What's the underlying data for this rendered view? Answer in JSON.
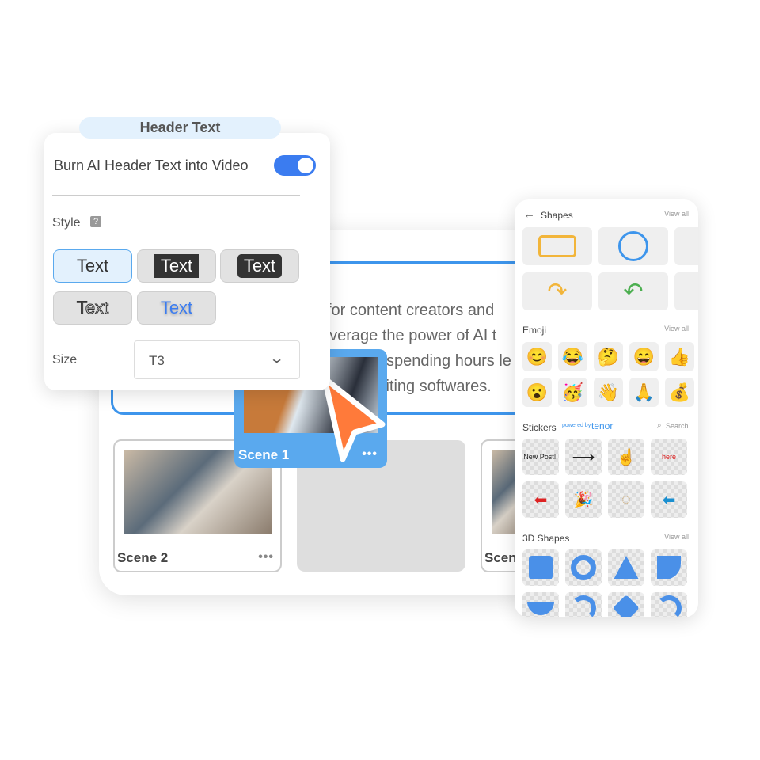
{
  "header_panel": {
    "pill": "Header Text",
    "burn_label": "Burn AI Header Text into Video",
    "burn_on": true,
    "style_label": "Style",
    "style_options": [
      "Text",
      "Text",
      "Text",
      "Text",
      "Text"
    ],
    "selected_style": 0,
    "size_label": "Size",
    "size_value": "T3"
  },
  "editor": {
    "lines": [
      "for content creators and",
      "everage the power of AI t",
      "spending hours le",
      "liting softwares."
    ],
    "scenes": [
      {
        "label": "Scene 2"
      },
      {
        "label": "Scen"
      }
    ],
    "dragged_scene": "Scene 1",
    "more": "•••"
  },
  "colors": {
    "accent": "#3d95ec",
    "toggle": "#3b7cf0",
    "cursor": "#ff7a3a"
  },
  "right_panel": {
    "shapes": {
      "title": "Shapes",
      "view_all": "View all"
    },
    "emoji": {
      "title": "Emoji",
      "view_all": "View all",
      "items": [
        "😊",
        "😂",
        "🤔",
        "😄",
        "👍",
        "😮",
        "🥳",
        "👋",
        "🙏",
        "💰"
      ]
    },
    "stickers": {
      "title": "Stickers",
      "powered": "powered by",
      "brand": "tenor",
      "search": "Search",
      "items": [
        "New Post!!",
        "⟶",
        "☝",
        "here",
        "⬅",
        "🎉",
        "◌",
        "⬅"
      ]
    },
    "shapes3d": {
      "title": "3D Shapes",
      "view_all": "View all"
    }
  }
}
